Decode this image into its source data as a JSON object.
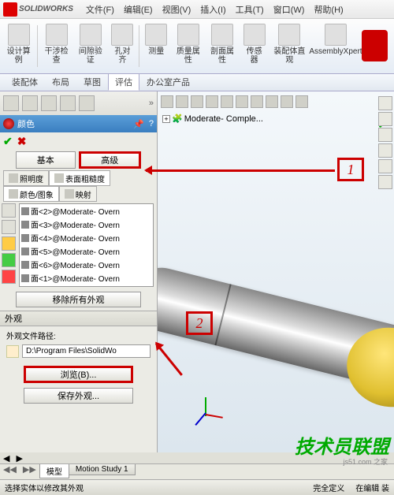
{
  "app": {
    "logo_text": "SOLIDWORKS"
  },
  "menu": [
    "文件(F)",
    "编辑(E)",
    "视图(V)",
    "插入(I)",
    "工具(T)",
    "窗口(W)",
    "帮助(H)"
  ],
  "ribbon": [
    {
      "label": "设计算例"
    },
    {
      "label": "干涉检查"
    },
    {
      "label": "间隙验证"
    },
    {
      "label": "孔对齐"
    },
    {
      "label": "测量"
    },
    {
      "label": "质量属性"
    },
    {
      "label": "剖面属性"
    },
    {
      "label": "传感器"
    },
    {
      "label": "装配体直观"
    },
    {
      "label": "AssemblyXpert"
    }
  ],
  "cmd_tabs": [
    "装配体",
    "布局",
    "草图",
    "评估",
    "办公室产品"
  ],
  "cmd_tabs_active": 3,
  "panel": {
    "title": "颜色",
    "basic": "基本",
    "advanced": "高级",
    "subtabs1": [
      {
        "label": "照明度",
        "active": false
      },
      {
        "label": "表面粗糙度",
        "active": true
      }
    ],
    "subtabs2": [
      {
        "label": "颜色/图象",
        "active": true
      },
      {
        "label": "映射",
        "active": false
      }
    ],
    "list": [
      "面<2>@Moderate- Overn",
      "面<3>@Moderate- Overn",
      "面<4>@Moderate- Overn",
      "面<5>@Moderate- Overn",
      "面<6>@Moderate- Overn",
      "面<1>@Moderate- Overn"
    ],
    "remove": "移除所有外观",
    "appearance_header": "外观",
    "path_label": "外观文件路径:",
    "path_value": "D:\\Program Files\\SolidWo",
    "browse": "浏览(B)...",
    "save": "保存外观..."
  },
  "viewport": {
    "tree_root": "Moderate- Comple..."
  },
  "annotations": {
    "one": "1",
    "two": "2"
  },
  "bottom_tabs": [
    "模型",
    "Motion Study 1"
  ],
  "status": {
    "left": "选择实体以修改其外观",
    "mid": "完全定义",
    "right": "在编辑 装"
  },
  "watermark": {
    "main": "技术员联盟",
    "sub": "js51.com 之家"
  }
}
